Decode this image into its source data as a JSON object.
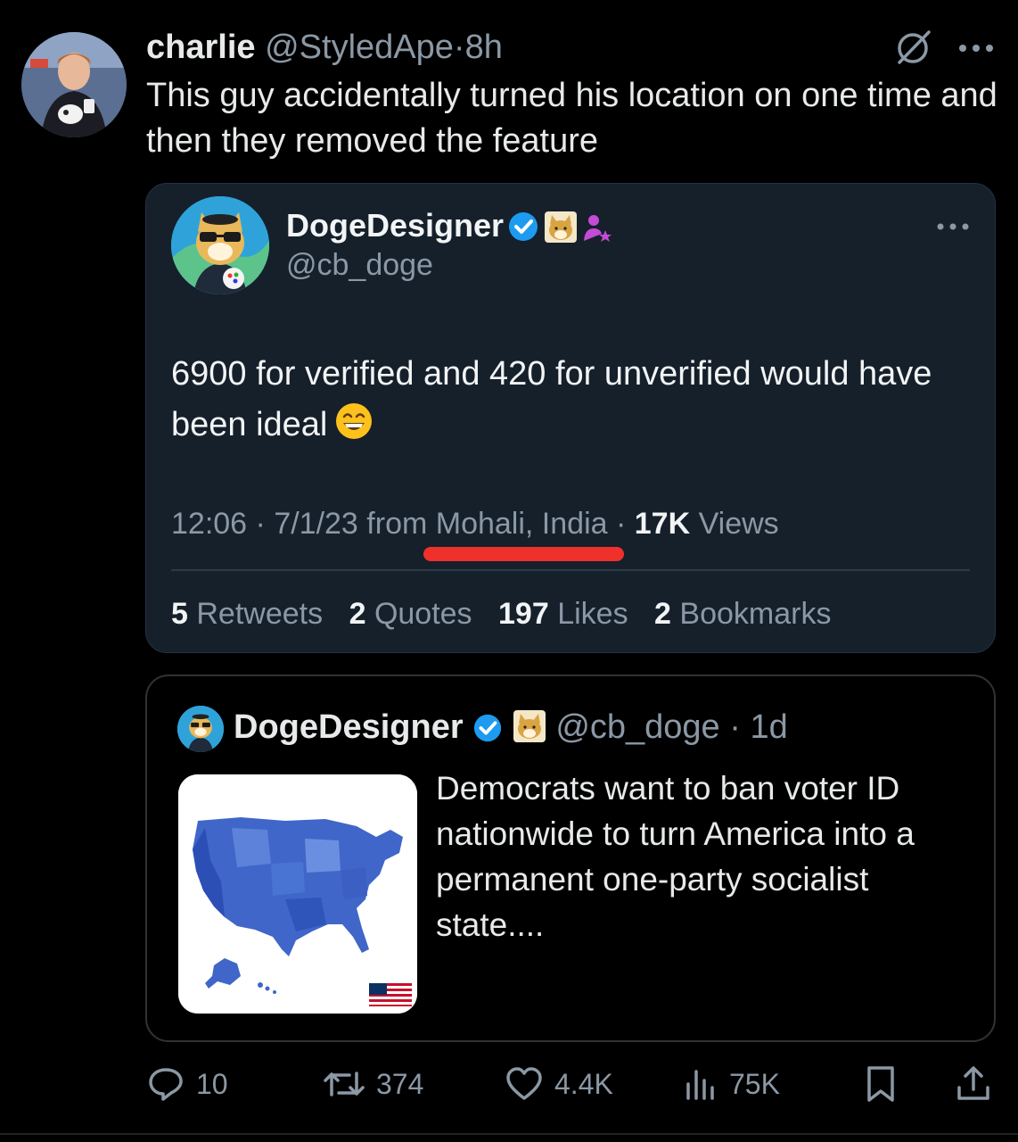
{
  "tweet": {
    "author_name": "charlie",
    "author_handle": "@StyledApe",
    "separator": "·",
    "time": "8h",
    "text": "This guy accidentally turned his location on one time and then they removed the feature"
  },
  "screenshot": {
    "author_name": "DogeDesigner",
    "author_handle": "@cb_doge",
    "text": "6900 for verified and 420 for unverified would have been ideal",
    "time": "12:06",
    "date": "7/1/23",
    "from_label": "from",
    "location": "Mohali, India",
    "views_count": "17K",
    "views_label": "Views",
    "stats": [
      {
        "count": "5",
        "label": "Retweets"
      },
      {
        "count": "2",
        "label": "Quotes"
      },
      {
        "count": "197",
        "label": "Likes"
      },
      {
        "count": "2",
        "label": "Bookmarks"
      }
    ]
  },
  "quote": {
    "author_name": "DogeDesigner",
    "author_handle": "@cb_doge",
    "time": "1d",
    "text": "Democrats want to ban voter ID nationwide to turn America into a permanent one-party socialist state...."
  },
  "actions": {
    "replies": "10",
    "retweets": "374",
    "likes": "4.4K",
    "views": "75K"
  },
  "colors": {
    "background": "#000000",
    "card_background": "#15202b",
    "secondary_text": "#8b98a5",
    "verified_blue": "#1d9bf0",
    "highlight_red": "#f0302b"
  },
  "icons": [
    "grok-icon",
    "more-icon",
    "verified-badge-icon",
    "doge-badge-icon",
    "affiliate-icon",
    "grin-emoji-icon",
    "reply-icon",
    "retweet-icon",
    "like-icon",
    "views-icon",
    "bookmark-icon",
    "share-icon"
  ]
}
